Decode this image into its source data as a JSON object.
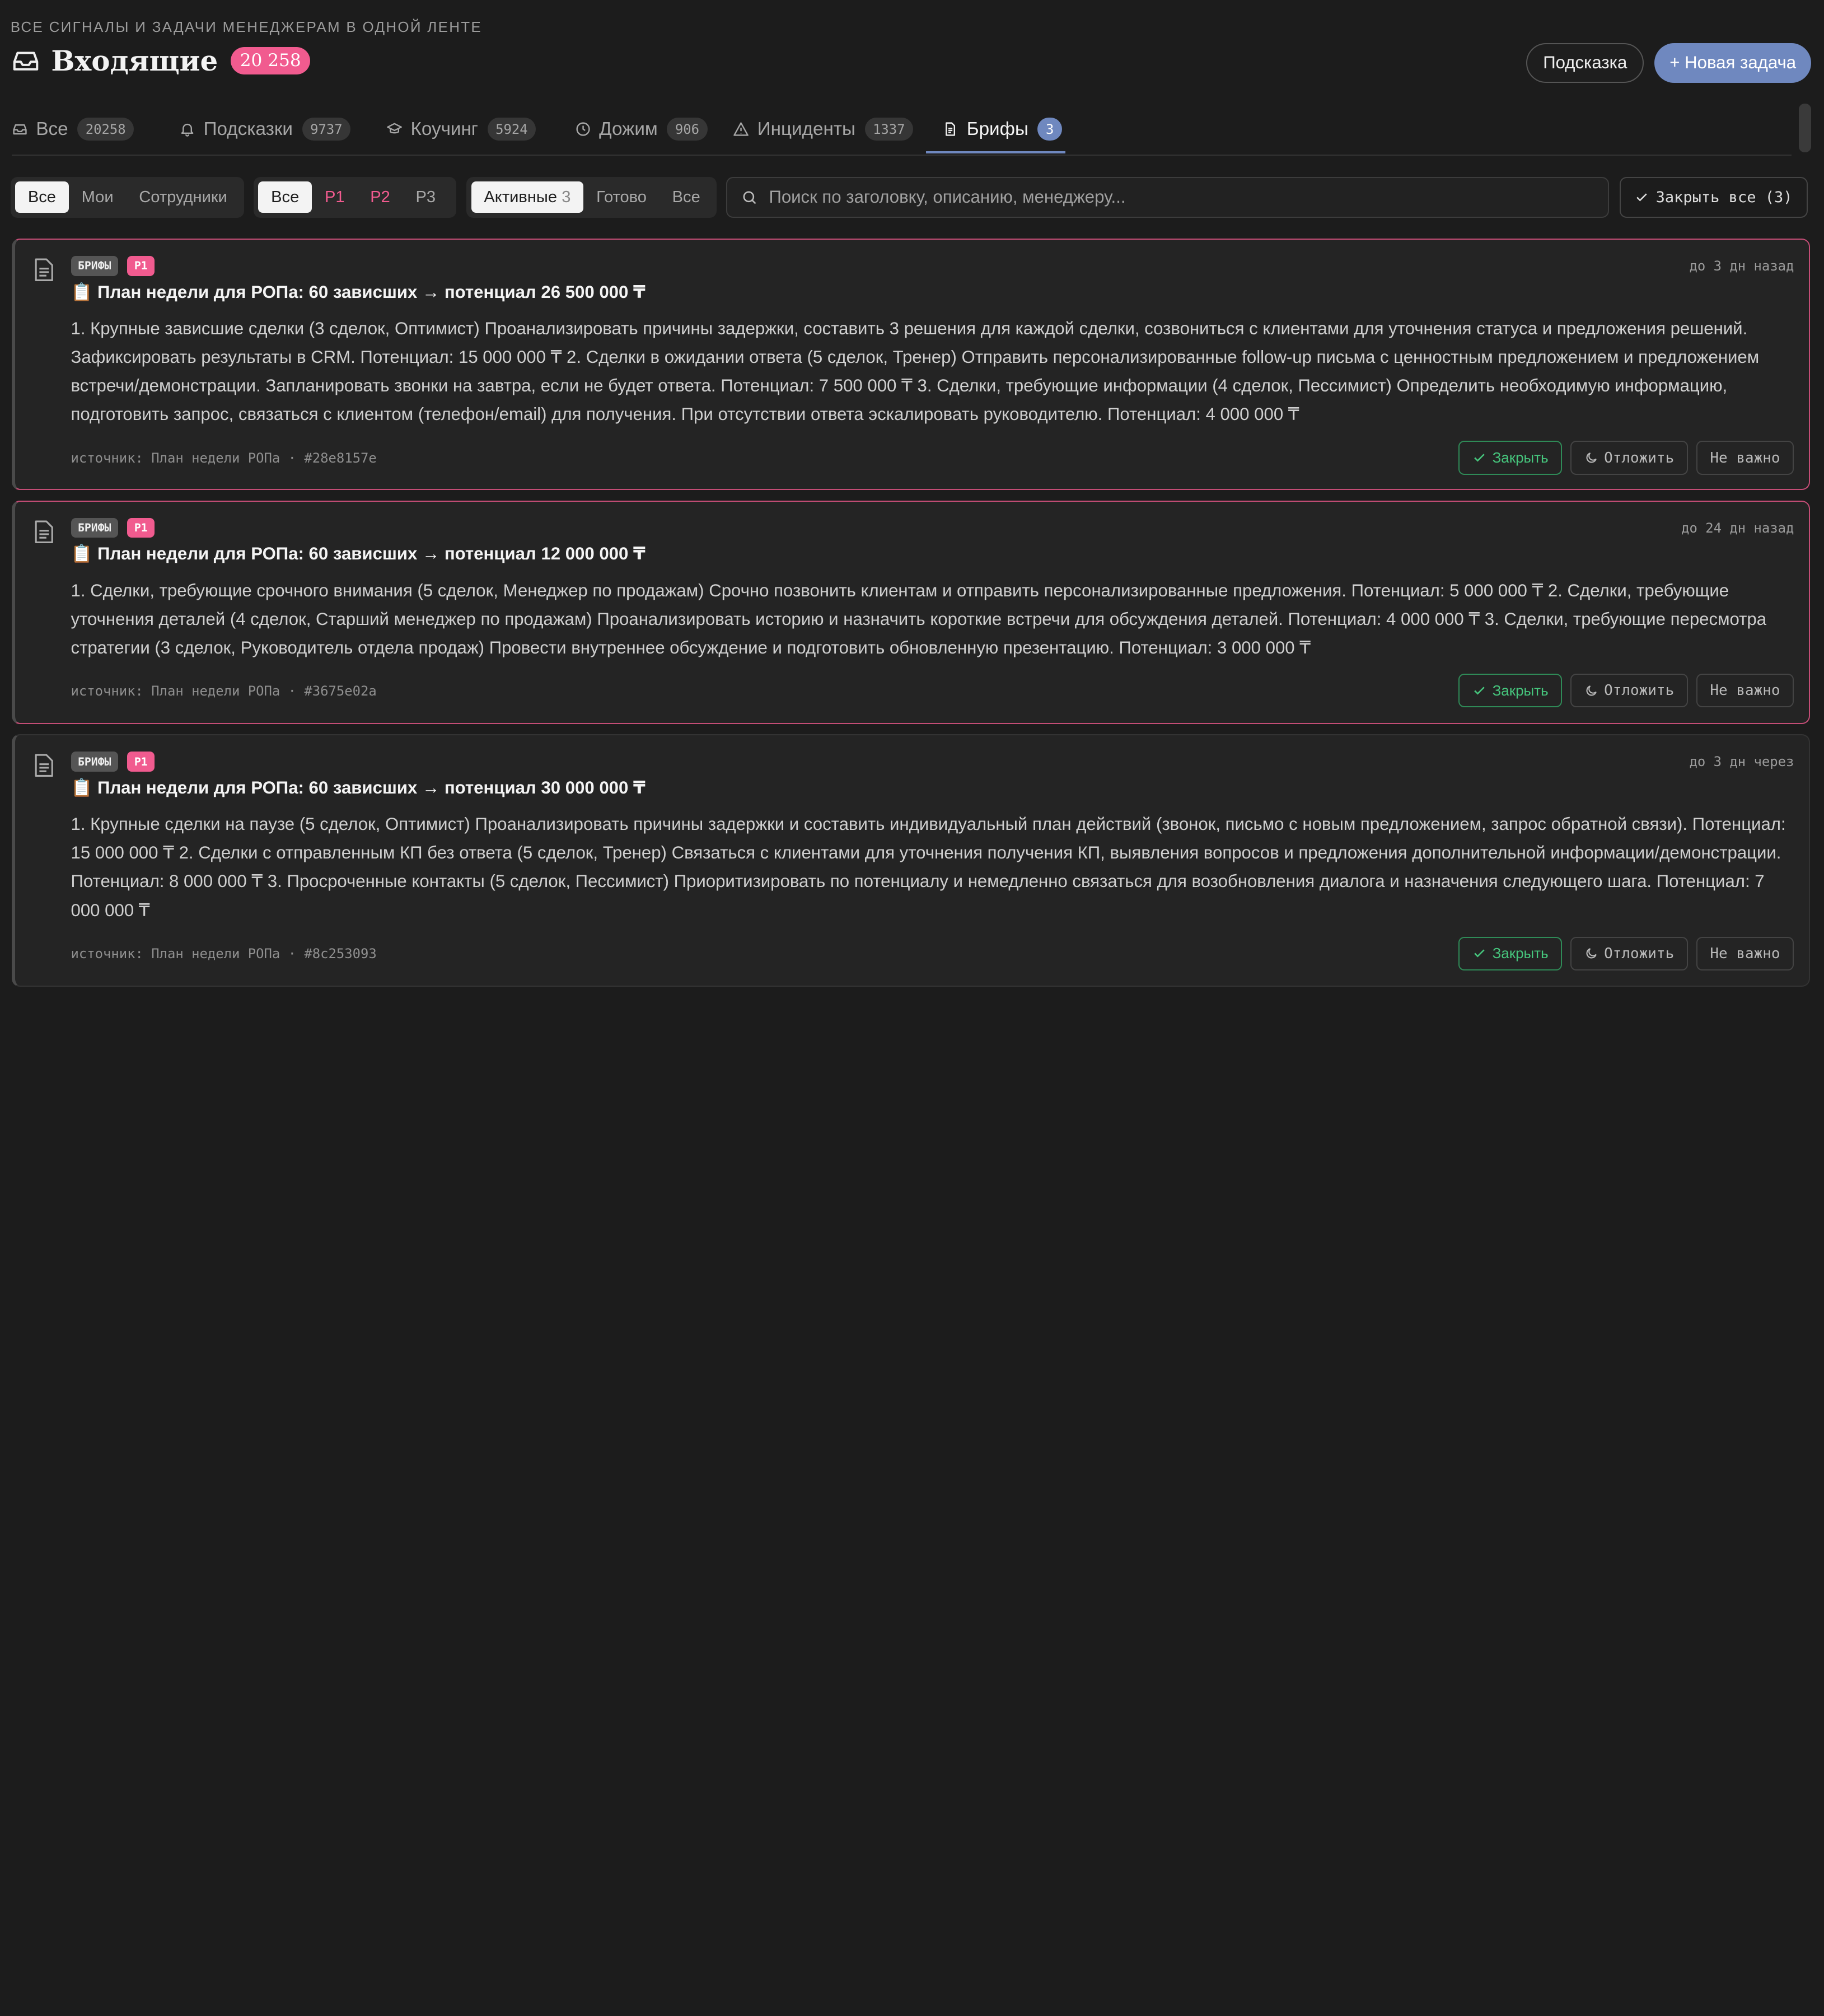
{
  "header": {
    "eyebrow": "ВСЕ СИГНАЛЫ И ЗАДАЧИ МЕНЕДЖЕРАМ В ОДНОЙ ЛЕНТЕ",
    "title": "Входящие",
    "count": "20 258",
    "hint_button": "Подсказка",
    "new_task_button": "+ Новая задача"
  },
  "tabs": [
    {
      "label": "Все",
      "count": "20258",
      "icon": "inbox-icon"
    },
    {
      "label": "Подсказки",
      "count": "9737",
      "icon": "bell-icon"
    },
    {
      "label": "Коучинг",
      "count": "5924",
      "icon": "graduation-cap-icon"
    },
    {
      "label": "Дожим",
      "count": "906",
      "icon": "clock-icon"
    },
    {
      "label": "Инциденты",
      "count": "1337",
      "icon": "warning-icon"
    },
    {
      "label": "Брифы",
      "count": "3",
      "icon": "document-icon",
      "active": true
    }
  ],
  "filters": {
    "owner": {
      "options": [
        "Все",
        "Мои",
        "Сотрудники"
      ],
      "selected": "Все"
    },
    "priority": {
      "options": [
        "Все",
        "P1",
        "P2",
        "P3"
      ],
      "selected": "Все"
    },
    "status": {
      "active_label": "Активные",
      "active_count": "3",
      "done_label": "Готово",
      "all_label": "Все",
      "selected": "Активные"
    },
    "search_placeholder": "Поиск по заголовку, описанию, менеджеру...",
    "close_all_label": "Закрыть все (3)"
  },
  "cards": [
    {
      "type_badge": "БРИФЫ",
      "priority": "P1",
      "when": "до 3 дн назад",
      "title": "📋 План недели для РОПа: 60 зависших → потенциал 26 500 000 ₸",
      "body": "1. Крупные зависшие сделки (3 сделок, Оптимист) Проанализировать причины задержки, составить 3 решения для каждой сделки, созвониться с клиентами для уточнения статуса и предложения решений. Зафиксировать результаты в CRM. Потенциал: 15 000 000 ₸ 2. Сделки в ожидании ответа (5 сделок, Тренер) Отправить персонализированные follow-up письма с ценностным предложением и предложением встречи/демонстрации. Запланировать звонки на завтра, если не будет ответа. Потенциал: 7 500 000 ₸ 3. Сделки, требующие информации (4 сделок, Пессимист) Определить необходимую информацию, подготовить запрос, связаться с клиентом (телефон/email) для получения. При отсутствии ответа эскалировать руководителю. Потенциал: 4 000 000 ₸",
      "source": "источник: План недели РОПа · #28e8157e",
      "actions": {
        "close": "Закрыть",
        "snooze": "Отложить",
        "not_important": "Не важно"
      }
    },
    {
      "type_badge": "БРИФЫ",
      "priority": "P1",
      "when": "до 24 дн назад",
      "title": "📋 План недели для РОПа: 60 зависших → потенциал 12 000 000 ₸",
      "body": "1. Сделки, требующие срочного внимания (5 сделок, Менеджер по продажам) Срочно позвонить клиентам и отправить персонализированные предложения. Потенциал: 5 000 000 ₸ 2. Сделки, требующие уточнения деталей (4 сделок, Старший менеджер по продажам) Проанализировать историю и назначить короткие встречи для обсуждения деталей. Потенциал: 4 000 000 ₸ 3. Сделки, требующие пересмотра стратегии (3 сделок, Руководитель отдела продаж) Провести внутреннее обсуждение и подготовить обновленную презентацию. Потенциал: 3 000 000 ₸",
      "source": "источник: План недели РОПа · #3675e02a",
      "actions": {
        "close": "Закрыть",
        "snooze": "Отложить",
        "not_important": "Не важно"
      }
    },
    {
      "type_badge": "БРИФЫ",
      "priority": "P1",
      "when": "до 3 дн через",
      "title": "📋 План недели для РОПа: 60 зависших → потенциал 30 000 000 ₸",
      "body": "1. Крупные сделки на паузе (5 сделок, Оптимист) Проанализировать причины задержки и составить индивидуальный план действий (звонок, письмо с новым предложением, запрос обратной связи). Потенциал: 15 000 000 ₸ 2. Сделки с отправленным КП без ответа (5 сделок, Тренер) Связаться с клиентами для уточнения получения КП, выявления вопросов и предложения дополнительной информации/демонстрации. Потенциал: 8 000 000 ₸ 3. Просроченные контакты (5 сделок, Пессимист) Приоритизировать по потенциалу и немедленно связаться для возобновления диалога и назначения следующего шага. Потенциал: 7 000 000 ₸",
      "source": "источник: План недели РОПа · #8c253093",
      "actions": {
        "close": "Закрыть",
        "snooze": "Отложить",
        "not_important": "Не важно"
      }
    }
  ],
  "colors": {
    "accent": "#6f88bf",
    "pink": "#f15b8f",
    "success": "#46c67d",
    "background": "#1c1c1c"
  }
}
